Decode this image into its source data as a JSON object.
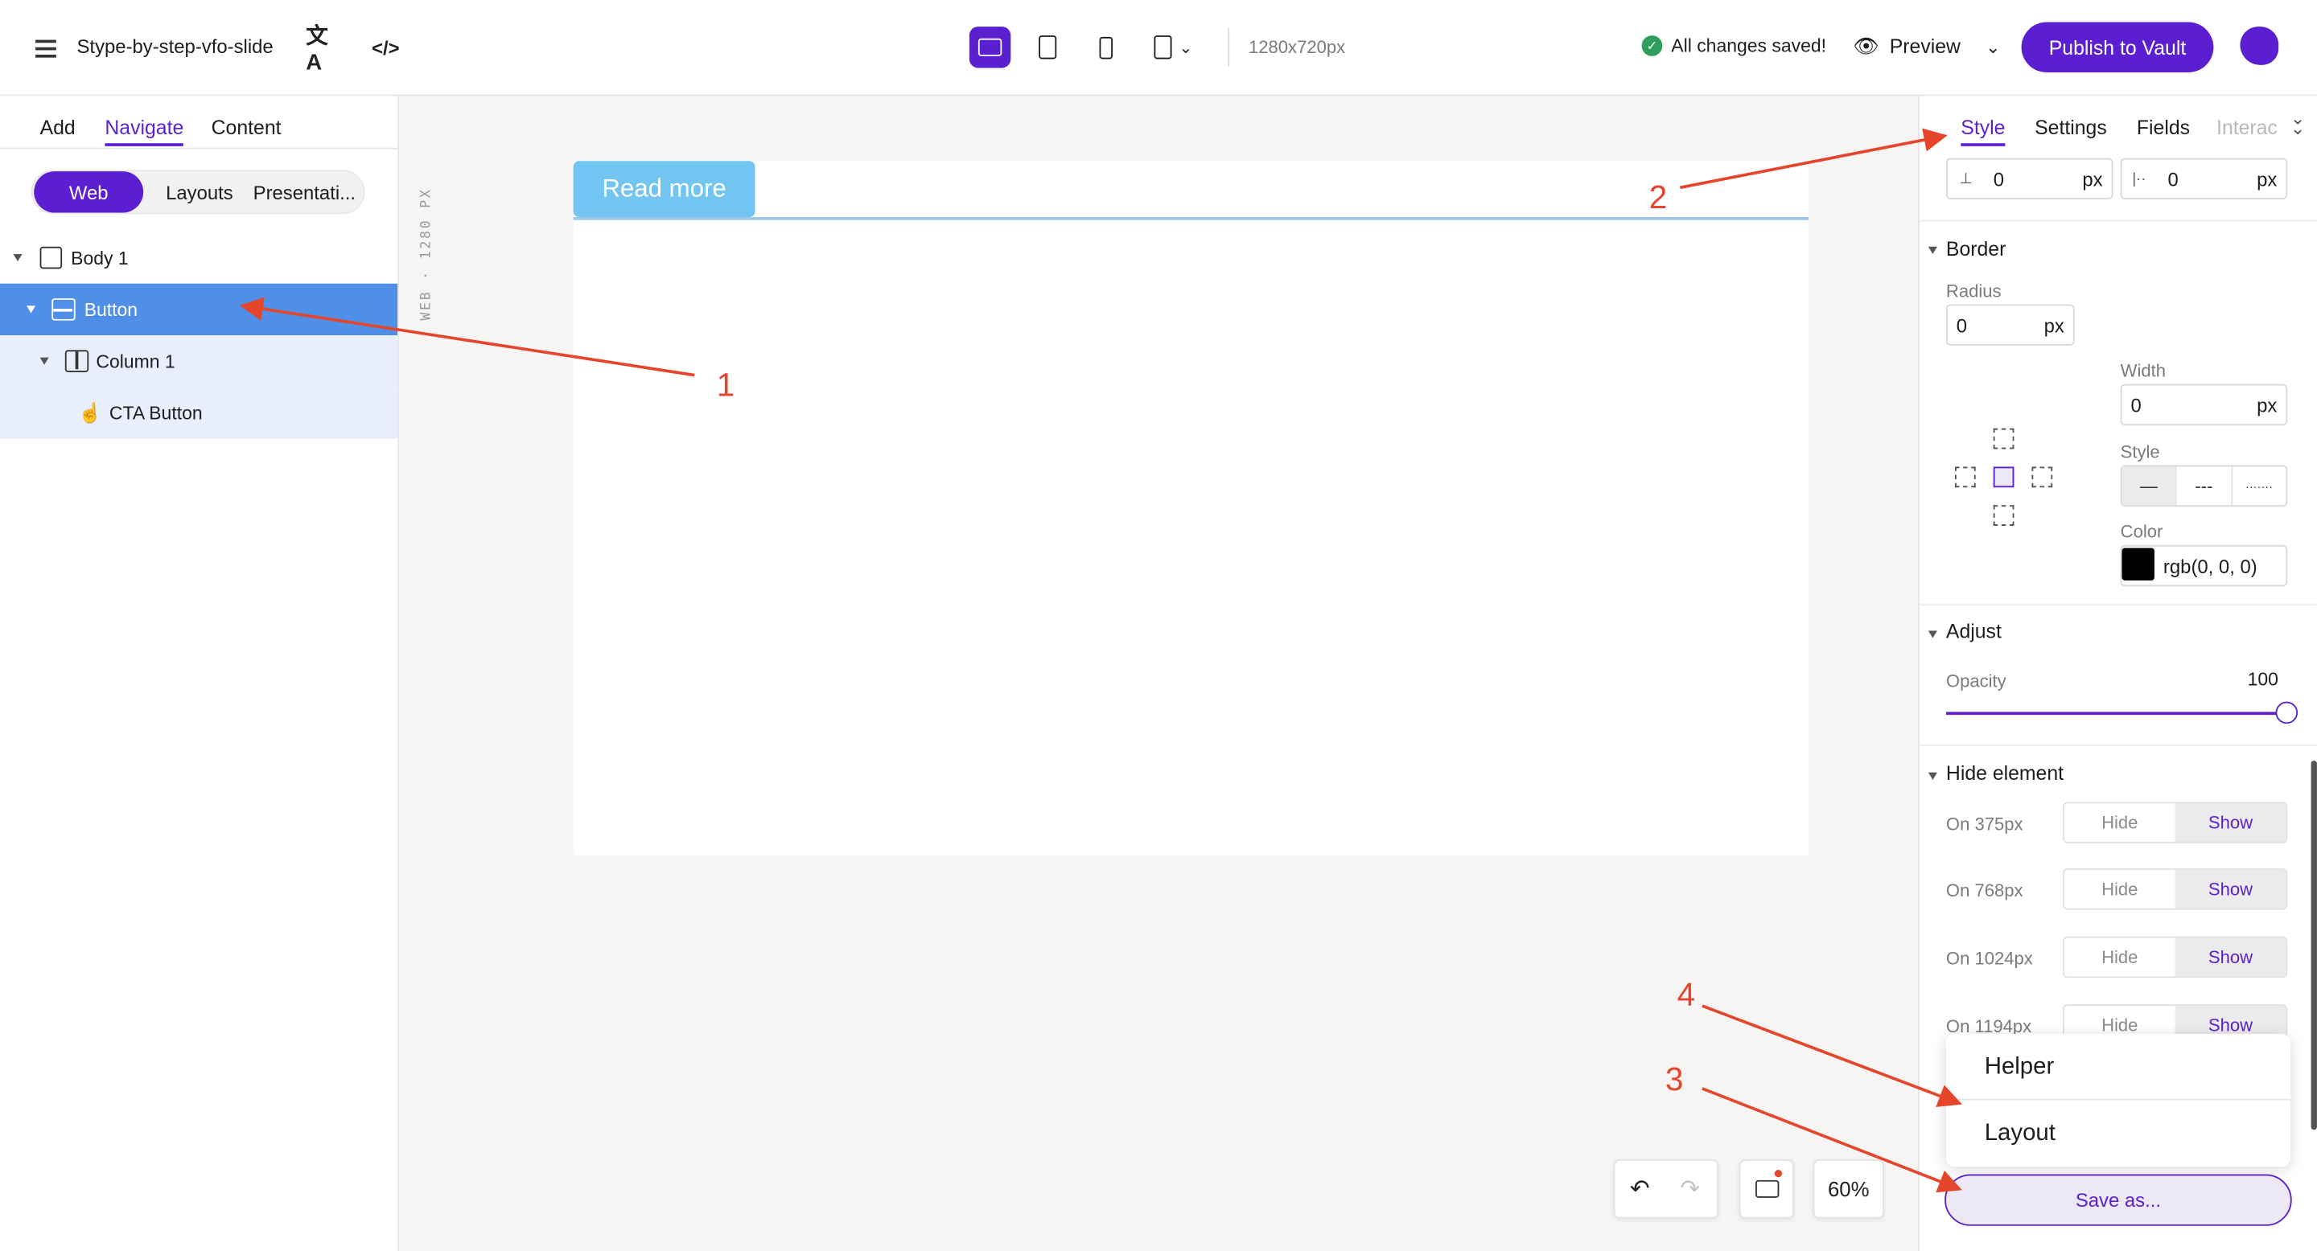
{
  "topbar": {
    "project_name": "Stype-by-step-vfo-slide",
    "canvas_size": "1280x720px",
    "save_status": "All changes saved!",
    "preview_label": "Preview",
    "publish_label": "Publish to Vault"
  },
  "left_panel": {
    "tabs": [
      "Add",
      "Navigate",
      "Content"
    ],
    "active_tab": "Navigate",
    "segments": [
      "Web",
      "Layouts",
      "Presentati..."
    ],
    "active_segment": "Web",
    "tree": [
      {
        "label": "Body 1",
        "icon": "box-icon"
      },
      {
        "label": "Button",
        "icon": "rows-icon",
        "selected": true
      },
      {
        "label": "Column 1",
        "icon": "columns-icon"
      },
      {
        "label": "CTA Button",
        "icon": "pointer-hand-icon"
      }
    ]
  },
  "canvas": {
    "ruler_label": "WEB · 1280 PX",
    "button_text": "Read more",
    "zoom": "60%"
  },
  "right_panel": {
    "tabs": [
      "Style",
      "Settings",
      "Fields",
      "Interac"
    ],
    "active_tab": "Style",
    "spacing": [
      {
        "value": "0",
        "unit": "px"
      },
      {
        "value": "0",
        "unit": "px"
      }
    ],
    "border": {
      "title": "Border",
      "radius_label": "Radius",
      "radius_value": "0",
      "radius_unit": "px",
      "width_label": "Width",
      "width_value": "0",
      "width_unit": "px",
      "style_label": "Style",
      "style_options": [
        "—",
        "---",
        "·······"
      ],
      "color_label": "Color",
      "color_value": "rgb(0, 0, 0)",
      "color_swatch": "#000000"
    },
    "adjust": {
      "title": "Adjust",
      "opacity_label": "Opacity",
      "opacity_value": "100"
    },
    "hide_element": {
      "title": "Hide element",
      "rows": [
        {
          "label": "On 375px",
          "hide": "Hide",
          "show": "Show"
        },
        {
          "label": "On 768px",
          "hide": "Hide",
          "show": "Show"
        },
        {
          "label": "On 1024px",
          "hide": "Hide",
          "show": "Show"
        },
        {
          "label": "On 1194px",
          "hide": "Hide",
          "show": "Show"
        }
      ]
    },
    "save_menu": [
      "Helper",
      "Layout"
    ],
    "save_as_label": "Save as..."
  },
  "annotations": [
    "1",
    "2",
    "3",
    "4"
  ],
  "colors": {
    "accent": "#5b1fd1",
    "selection": "#4f8fe8",
    "annotation": "#e5462b",
    "button_preview": "#72c5f0"
  }
}
